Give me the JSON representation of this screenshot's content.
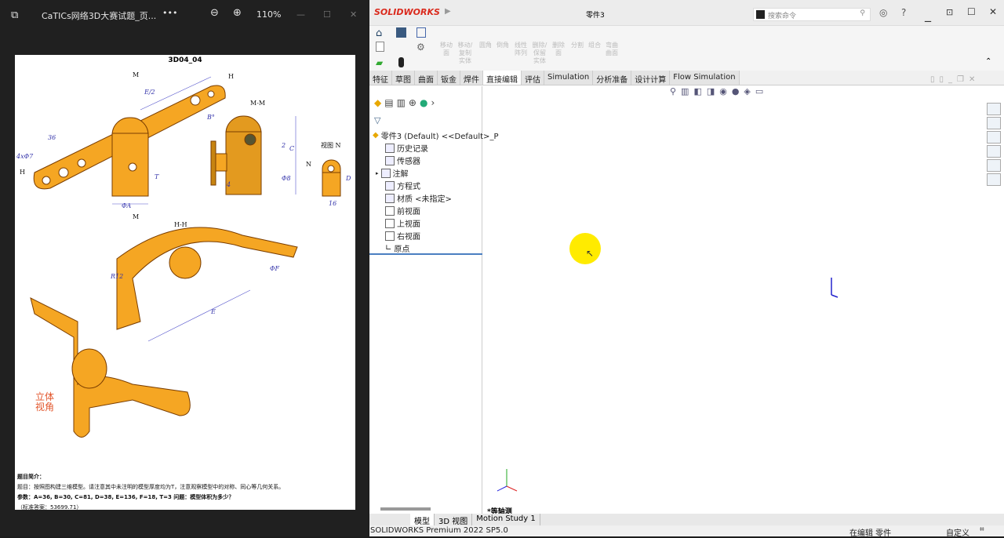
{
  "viewer": {
    "title": "CaTICs网络3D大赛试题_页...",
    "more": "•••",
    "zoom": "110%",
    "icons": [
      "image-icon",
      "zoom-out-icon",
      "zoom-in-icon",
      "minimize-icon",
      "maximize-icon",
      "close-icon"
    ]
  },
  "drawing": {
    "title": "3D04_04",
    "labels": {
      "mm": "M-M",
      "hh": "H-H",
      "viewN": "视图 N",
      "M": "M",
      "H": "H",
      "N": "N",
      "E2": "E/2",
      "B": "B°",
      "A": "ΦA",
      "T": "T",
      "C": "C",
      "D": "D",
      "E": "E",
      "F": "ΦF",
      "R": "R12",
      "d36": "36",
      "d16": "16",
      "d4": "4",
      "d2": "2",
      "hole": "4xΦ7",
      "d8": "Φ8"
    },
    "stereo": "立体\n视角",
    "intro_title": "题目简介：",
    "intro_q": "题目：按照图构建三维模型。请注意其中未注明的模型厚度均为T，注意观察模型中的对称、同心等几何关系。",
    "params": "参数：A=36, B=30, C=81, D=38, E=136, F=18, T=3 问题：模型体积为多少？",
    "answer": "（标准答案：53699.71）"
  },
  "sw": {
    "brand": "SOLIDWORKS",
    "doc_title": "零件3",
    "search_placeholder": "搜索命令",
    "ribbon": [
      "移动面",
      "移动/复制实体",
      "圆角",
      "倒角",
      "线性阵列",
      "删除/保留实体",
      "删除面",
      "分割",
      "组合",
      "弯曲曲面"
    ],
    "tabs": [
      "特征",
      "草图",
      "曲面",
      "钣金",
      "焊件",
      "直接编辑",
      "评估",
      "Simulation",
      "分析准备",
      "设计计算",
      "Flow Simulation"
    ],
    "active_tab": "直接编辑",
    "tree": {
      "root": "零件3 (Default) <<Default>_P",
      "items": [
        "历史记录",
        "传感器",
        "注解",
        "方程式",
        "材质 <未指定>",
        "前视面",
        "上视面",
        "右视面",
        "原点"
      ]
    },
    "view_label": "*等轴测",
    "bottom_tabs": [
      "模型",
      "3D 视图",
      "Motion Study 1"
    ],
    "status": {
      "version": "SOLIDWORKS Premium 2022 SP5.0",
      "mode": "在编辑 零件",
      "units": "自定义"
    },
    "colors": {
      "accent": "#da291c",
      "part": "#f5a623",
      "cursor_highlight": "#ffeb00"
    }
  }
}
